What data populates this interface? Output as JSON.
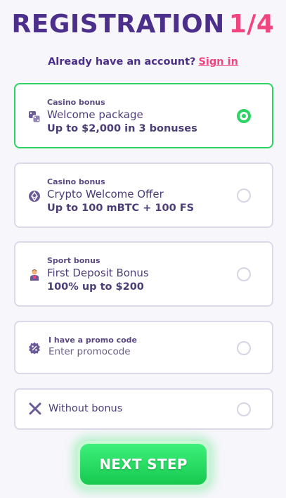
{
  "header": {
    "title": "REGISTRATION",
    "step": "1/4",
    "signin_prompt": "Already have an account?",
    "signin_link": "Sign in"
  },
  "options": [
    {
      "category": "Casino bonus",
      "name": "Welcome package",
      "detail": "Up to $2,000 in 3 bonuses",
      "icon": "dice-icon",
      "selected": true
    },
    {
      "category": "Casino bonus",
      "name": "Crypto Welcome Offer",
      "detail": "Up to 100 mBTC + 100 FS",
      "icon": "crypto-coin-icon",
      "selected": false
    },
    {
      "category": "Sport bonus",
      "name": "First Deposit Bonus",
      "detail": "100% up to $200",
      "icon": "athlete-icon",
      "selected": false
    }
  ],
  "promo": {
    "label": "I have a promo code",
    "placeholder": "Enter promocode",
    "icon": "percent-badge-icon"
  },
  "no_bonus": {
    "label": "Without bonus",
    "icon": "close-icon"
  },
  "next_button": {
    "label": "NEXT STEP"
  },
  "colors": {
    "title": "#4b2f8a",
    "accent": "#f0457e",
    "selected": "#2bd463"
  }
}
